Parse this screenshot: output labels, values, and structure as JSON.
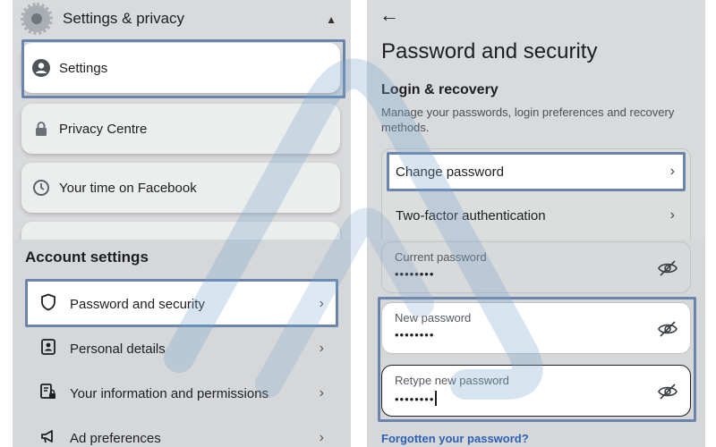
{
  "left_top": {
    "header": {
      "title": "Settings & privacy",
      "icon": "gear-icon",
      "toggle_icon": "chevron-up-icon"
    },
    "items": [
      {
        "label": "Settings",
        "icon": "profile-icon",
        "active": true
      },
      {
        "label": "Privacy Centre",
        "icon": "lock-icon",
        "active": false
      },
      {
        "label": "Your time on Facebook",
        "icon": "clock-icon",
        "active": false
      }
    ]
  },
  "left_bottom": {
    "title": "Account settings",
    "items": [
      {
        "label": "Password and security",
        "icon": "shield-icon",
        "active": true
      },
      {
        "label": "Personal details",
        "icon": "id-card-icon",
        "active": false
      },
      {
        "label": "Your information and permissions",
        "icon": "document-lock-icon",
        "active": false
      },
      {
        "label": "Ad preferences",
        "icon": "megaphone-icon",
        "active": false
      }
    ]
  },
  "right_top": {
    "back_icon": "back-arrow-icon",
    "title": "Password and security",
    "section_title": "Login & recovery",
    "section_desc": "Manage your passwords, login preferences and recovery methods.",
    "rows": [
      {
        "label": "Change password",
        "active": true
      },
      {
        "label": "Two-factor authentication",
        "active": false
      }
    ]
  },
  "right_bottom": {
    "fields": [
      {
        "label": "Current password",
        "value": "••••••••",
        "icon": "eye-off-icon"
      },
      {
        "label": "New password",
        "value": "••••••••",
        "icon": "eye-off-icon"
      },
      {
        "label": "Retype new password",
        "value": "••••••••",
        "icon": "eye-off-icon"
      }
    ],
    "forgot_link": "Forgotten your password?"
  },
  "colors": {
    "highlight": "#6b84ad",
    "link": "#2d5fb7",
    "dim_background": "#d9dadb"
  }
}
